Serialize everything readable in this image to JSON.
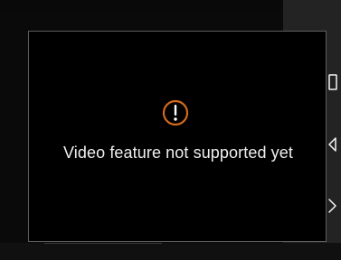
{
  "overlay": {
    "message": "Video feature not supported yet",
    "icon": "warning-icon",
    "accent_color": "#d2691e",
    "text_color": "#efefef"
  },
  "sidebar": {
    "items": [
      {
        "icon": "square-icon"
      },
      {
        "icon": "back-triangle-icon"
      },
      {
        "icon": "chevron-right-icon"
      }
    ]
  }
}
